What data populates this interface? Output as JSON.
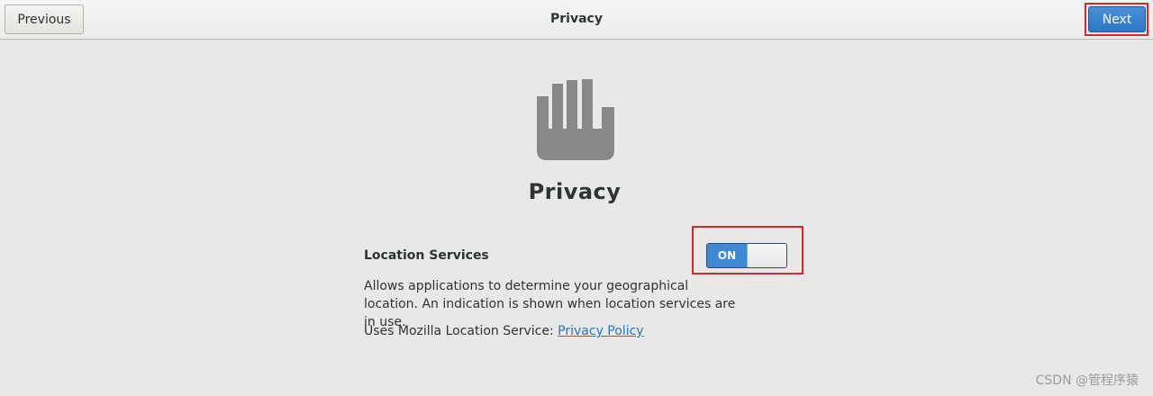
{
  "header": {
    "previous_label": "Previous",
    "title": "Privacy",
    "next_label": "Next"
  },
  "main": {
    "icon": "hand-stop-icon",
    "title": "Privacy",
    "location_services": {
      "label": "Location Services",
      "toggle_state": "ON",
      "description": "Allows applications to determine your geographical location. An indication is shown when location services are in use.",
      "uses_prefix": "Uses Mozilla Location Service: ",
      "policy_link": "Privacy Policy"
    }
  },
  "colors": {
    "accent": "#3f88d4",
    "highlight": "#d9262c"
  },
  "watermark": "CSDN @管程序猿"
}
